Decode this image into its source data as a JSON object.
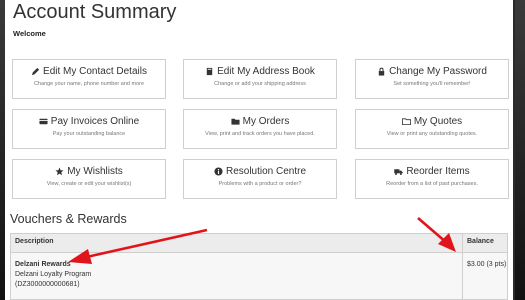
{
  "page": {
    "title": "Account Summary",
    "welcome": "Welcome"
  },
  "tiles": [
    {
      "title": "Edit My Contact Details",
      "desc": "Change your name, phone number and more",
      "icon": "pencil-icon"
    },
    {
      "title": "Edit My Address Book",
      "desc": "Change or add your shipping address",
      "icon": "book-icon"
    },
    {
      "title": "Change My Password",
      "desc": "Set something you'll remember!",
      "icon": "lock-icon"
    },
    {
      "title": "Pay Invoices Online",
      "desc": "Pay your outstanding balance",
      "icon": "credit-card-icon"
    },
    {
      "title": "My Orders",
      "desc": "View, print and track orders you have placed.",
      "icon": "folder-icon"
    },
    {
      "title": "My Quotes",
      "desc": "View or print any outstanding quotes.",
      "icon": "folder-open-icon"
    },
    {
      "title": "My Wishlists",
      "desc": "View, create or edit your wishlist(s)",
      "icon": "star-icon"
    },
    {
      "title": "Resolution Centre",
      "desc": "Problems with a product or order?",
      "icon": "info-icon"
    },
    {
      "title": "Reorder Items",
      "desc": "Reorder from a list of past purchases.",
      "icon": "truck-icon"
    }
  ],
  "vouchers": {
    "title": "Vouchers & Rewards",
    "headers": {
      "description": "Description",
      "balance": "Balance"
    },
    "row": {
      "name": "Delzani Rewards",
      "program": "Delzani Loyalty Program",
      "code": "(DZ3000000000681)",
      "balance": "$3.00 (3 pts)"
    }
  },
  "colors": {
    "arrow": "#e0141b",
    "text": "#333333",
    "border": "#cfcfcf"
  }
}
